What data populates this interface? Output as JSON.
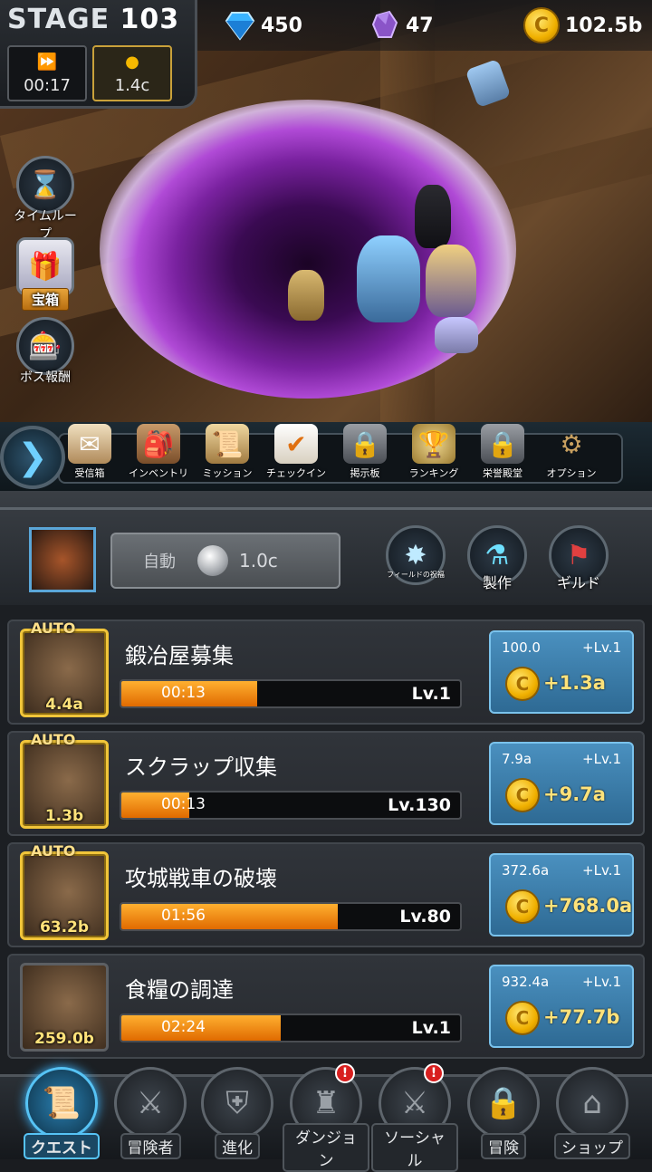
{
  "hud": {
    "stage_label": "STAGE",
    "stage_number": "103",
    "speed_icon": "fast-forward-icon",
    "timer": "00:17",
    "gold_rate": "1.4c",
    "diamonds": "450",
    "crystals": "47",
    "gold": "102.5b"
  },
  "side": {
    "time_loop": "タイムループ",
    "treasure": "宝箱",
    "boss_reward": "ボス報酬"
  },
  "menu": [
    {
      "label": "受信箱",
      "icon": "mail-icon"
    },
    {
      "label": "インベントリ",
      "icon": "backpack-icon"
    },
    {
      "label": "ミッション",
      "icon": "scroll-icon"
    },
    {
      "label": "チェックイン",
      "icon": "calendar-check-icon"
    },
    {
      "label": "掲示板",
      "icon": "lock-icon"
    },
    {
      "label": "ランキング",
      "icon": "trophy-icon"
    },
    {
      "label": "栄誉殿堂",
      "icon": "lock-icon"
    },
    {
      "label": "オプション",
      "icon": "gear-icon"
    }
  ],
  "mid": {
    "auto_label": "自動",
    "auto_cost": "1.0c",
    "field_blessing": "フィールドの祝福",
    "craft": "製作",
    "guild": "ギルド"
  },
  "quests": [
    {
      "auto": "AUTO",
      "value": "4.4a",
      "title": "鍛冶屋募集",
      "time": "00:13",
      "level": "Lv.1",
      "progress": 0.4,
      "cost": "100.0",
      "lv_up": "+Lv.1",
      "gain": "+1.3a"
    },
    {
      "auto": "AUTO",
      "value": "1.3b",
      "title": "スクラップ収集",
      "time": "00:13",
      "level": "Lv.130",
      "progress": 0.2,
      "cost": "7.9a",
      "lv_up": "+Lv.1",
      "gain": "+9.7a"
    },
    {
      "auto": "AUTO",
      "value": "63.2b",
      "title": "攻城戦車の破壊",
      "time": "01:56",
      "level": "Lv.80",
      "progress": 0.64,
      "cost": "372.6a",
      "lv_up": "+Lv.1",
      "gain": "+768.0a"
    },
    {
      "auto": "",
      "value": "259.0b",
      "title": "食糧の調達",
      "time": "02:24",
      "level": "Lv.1",
      "progress": 0.47,
      "cost": "932.4a",
      "lv_up": "+Lv.1",
      "gain": "+77.7b"
    }
  ],
  "nav": [
    {
      "label": "クエスト",
      "icon": "scroll-icon",
      "active": true,
      "alert": ""
    },
    {
      "label": "冒険者",
      "icon": "helmet-icon",
      "active": false,
      "alert": ""
    },
    {
      "label": "進化",
      "icon": "shield-icon",
      "active": false,
      "alert": ""
    },
    {
      "label": "ダンジョン",
      "icon": "castle-icon",
      "active": false,
      "alert": "!"
    },
    {
      "label": "ソーシャル",
      "icon": "swords-icon",
      "active": false,
      "alert": "!"
    },
    {
      "label": "冒険",
      "icon": "lock-icon",
      "active": false,
      "alert": ""
    },
    {
      "label": "ショップ",
      "icon": "shop-icon",
      "active": false,
      "alert": ""
    }
  ]
}
